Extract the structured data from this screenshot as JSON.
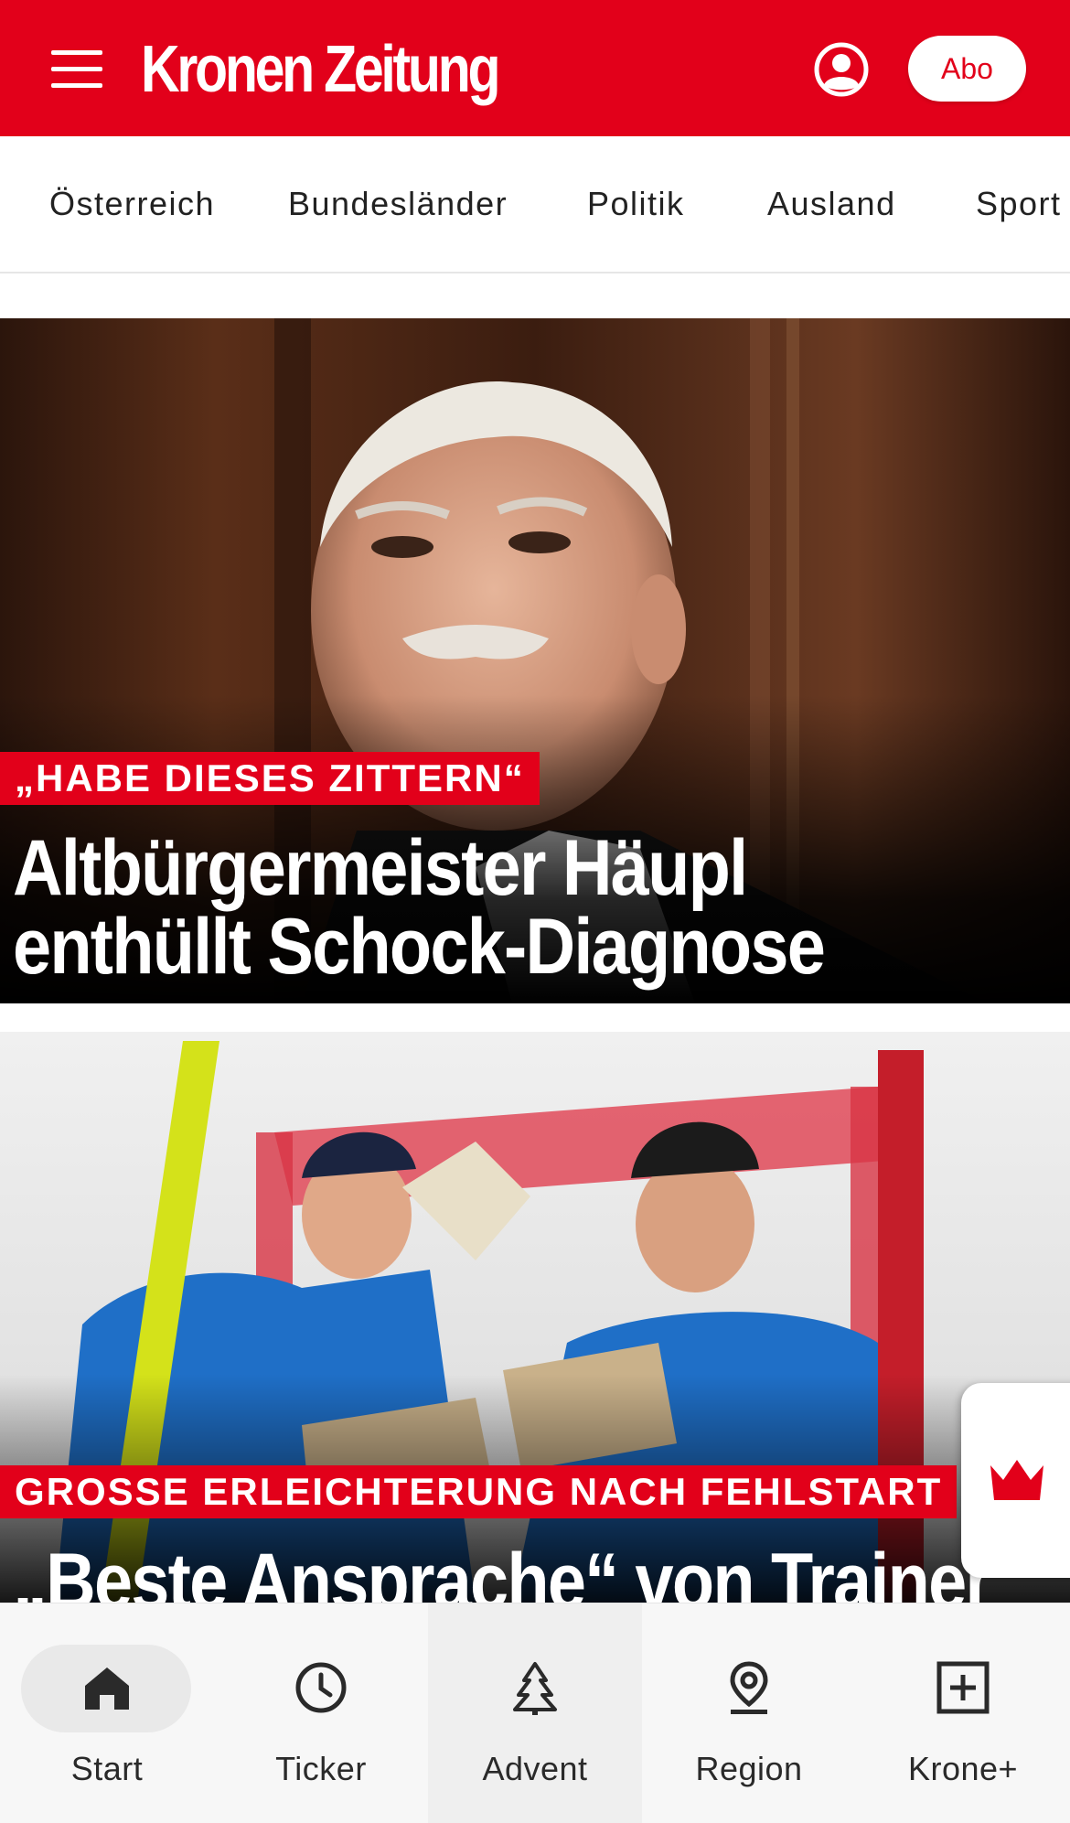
{
  "header": {
    "menu_icon": "hamburger-menu-icon",
    "logo_text": "Kronen Zeitung",
    "user_icon": "user-account-icon",
    "abo_label": "Abo",
    "brand_color": "#e2001a"
  },
  "nav": {
    "items": [
      {
        "label": "Österreich"
      },
      {
        "label": "Bundesländer"
      },
      {
        "label": "Politik"
      },
      {
        "label": "Ausland"
      },
      {
        "label": "Sport"
      }
    ]
  },
  "articles": [
    {
      "kicker": "„HABE DIESES ZITTERN“",
      "headline_line1": "Altbürgermeister Häupl",
      "headline_line2": "enthüllt Schock-Diagnose",
      "image": "portrait-photo-older-man"
    },
    {
      "kicker": "GROSSE ERLEICHTERUNG NACH FEHLSTART",
      "headline_line1": "„Beste Ansprache“ von Trainer",
      "image": "ski-racers-with-trophies-photo"
    }
  ],
  "floating_button": {
    "icon": "krone-crown-icon"
  },
  "bottom_nav": {
    "items": [
      {
        "label": "Start",
        "icon": "home-icon",
        "selected": true
      },
      {
        "label": "Ticker",
        "icon": "clock-icon"
      },
      {
        "label": "Advent",
        "icon": "christmas-tree-icon"
      },
      {
        "label": "Region",
        "icon": "location-pin-icon"
      },
      {
        "label": "Krone+",
        "icon": "plus-box-icon"
      }
    ]
  }
}
